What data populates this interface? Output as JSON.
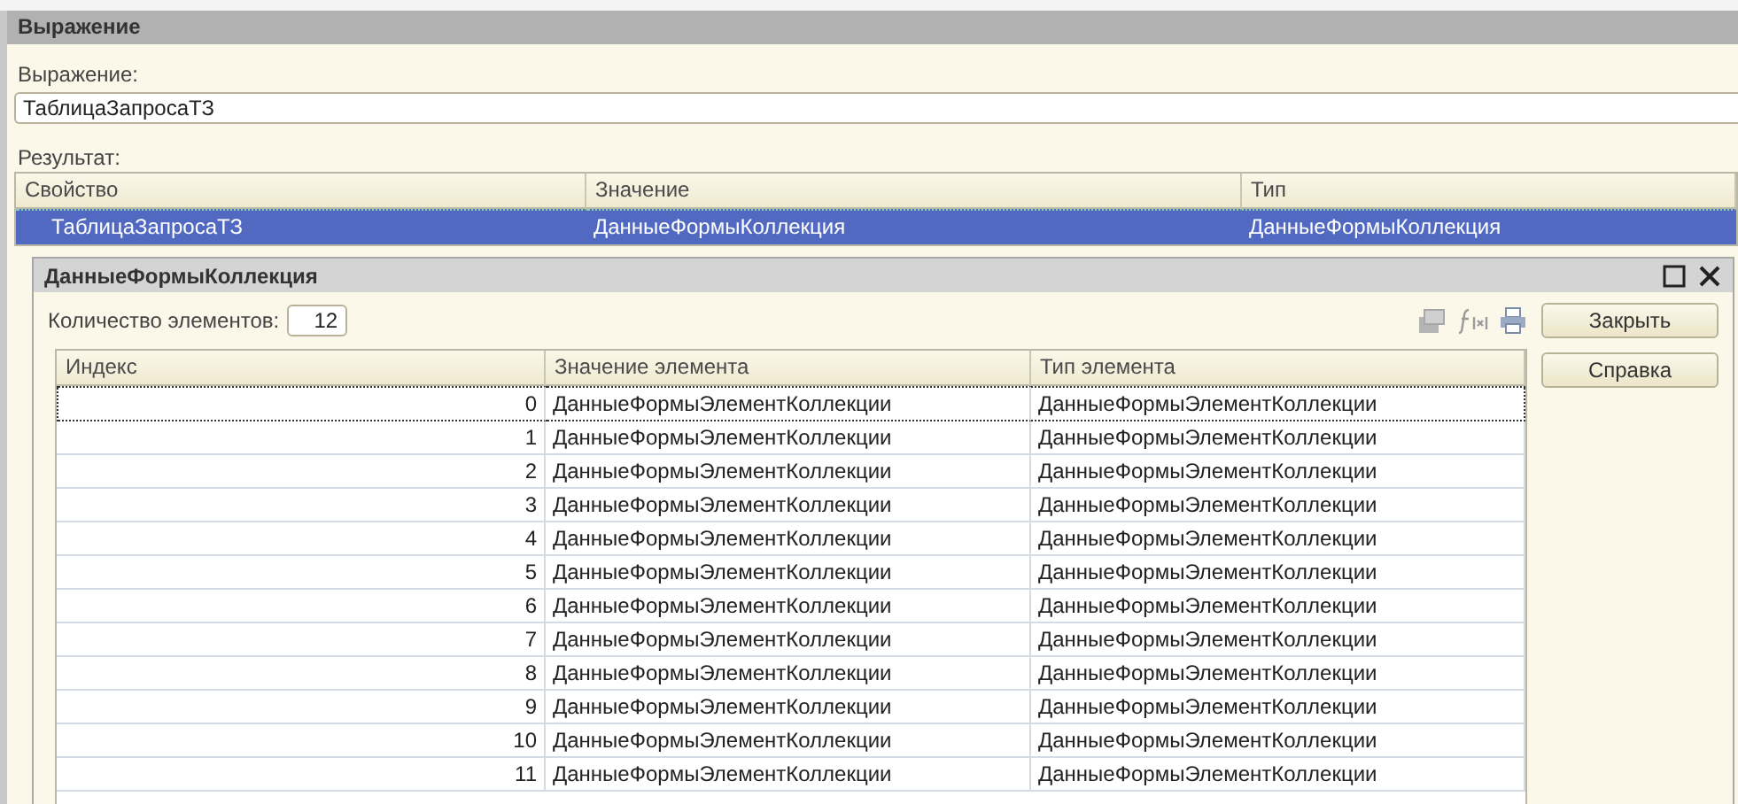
{
  "window": {
    "title": "Выражение"
  },
  "expression": {
    "label": "Выражение:",
    "value": "ТаблицаЗапросаТЗ"
  },
  "result": {
    "label": "Результат:",
    "columns": [
      "Свойство",
      "Значение",
      "Тип"
    ],
    "rows": [
      {
        "cells": [
          "ТаблицаЗапросаТЗ",
          "ДанныеФормыКоллекция",
          "ДанныеФормыКоллекция"
        ],
        "selected": true
      }
    ]
  },
  "dialog": {
    "title": "ДанныеФормыКоллекция",
    "count_label": "Количество элементов:",
    "count": "12",
    "columns": [
      "Индекс",
      "Значение элемента",
      "Тип элемента"
    ],
    "rows": [
      {
        "cells": [
          "0",
          "ДанныеФормыЭлементКоллекции",
          "ДанныеФормыЭлементКоллекции"
        ],
        "selected": true
      },
      {
        "cells": [
          "1",
          "ДанныеФормыЭлементКоллекции",
          "ДанныеФормыЭлементКоллекции"
        ],
        "selected": false
      },
      {
        "cells": [
          "2",
          "ДанныеФормыЭлементКоллекции",
          "ДанныеФормыЭлементКоллекции"
        ],
        "selected": false
      },
      {
        "cells": [
          "3",
          "ДанныеФормыЭлементКоллекции",
          "ДанныеФормыЭлементКоллекции"
        ],
        "selected": false
      },
      {
        "cells": [
          "4",
          "ДанныеФормыЭлементКоллекции",
          "ДанныеФормыЭлементКоллекции"
        ],
        "selected": false
      },
      {
        "cells": [
          "5",
          "ДанныеФормыЭлементКоллекции",
          "ДанныеФормыЭлементКоллекции"
        ],
        "selected": false
      },
      {
        "cells": [
          "6",
          "ДанныеФормыЭлементКоллекции",
          "ДанныеФормыЭлементКоллекции"
        ],
        "selected": false
      },
      {
        "cells": [
          "7",
          "ДанныеФормыЭлементКоллекции",
          "ДанныеФормыЭлементКоллекции"
        ],
        "selected": false
      },
      {
        "cells": [
          "8",
          "ДанныеФормыЭлементКоллекции",
          "ДанныеФормыЭлементКоллекции"
        ],
        "selected": false
      },
      {
        "cells": [
          "9",
          "ДанныеФормыЭлементКоллекции",
          "ДанныеФормыЭлементКоллекции"
        ],
        "selected": false
      },
      {
        "cells": [
          "10",
          "ДанныеФормыЭлементКоллекции",
          "ДанныеФормыЭлементКоллекции"
        ],
        "selected": false
      },
      {
        "cells": [
          "11",
          "ДанныеФормыЭлементКоллекции",
          "ДанныеФормыЭлементКоллекции"
        ],
        "selected": false
      }
    ],
    "buttons": [
      "Закрыть",
      "Справка"
    ]
  }
}
